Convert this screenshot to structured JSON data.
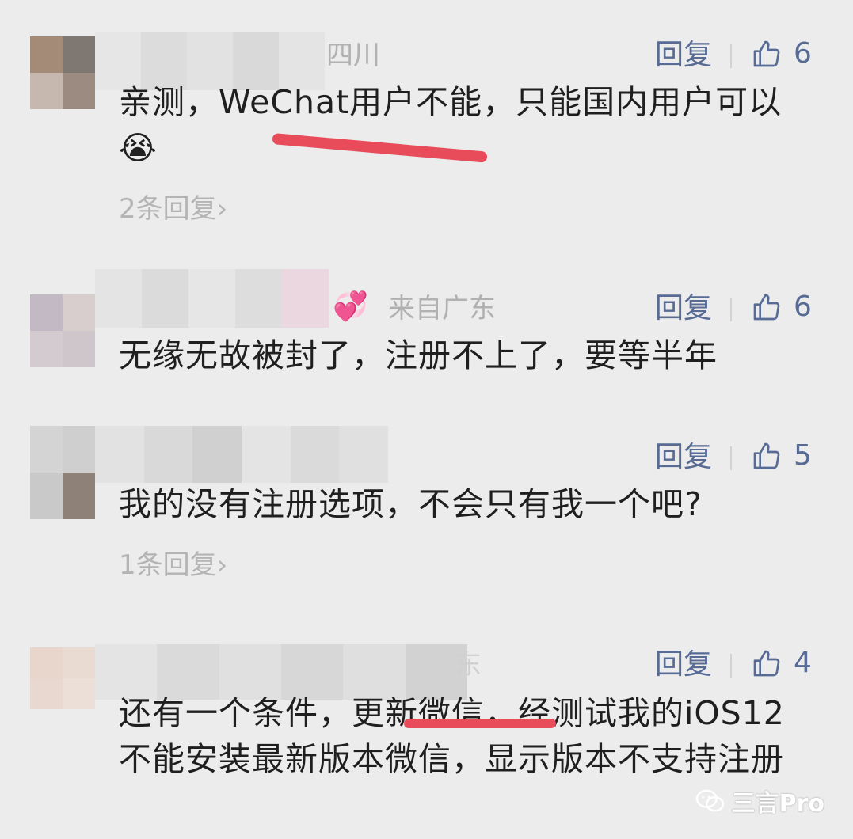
{
  "comments": [
    {
      "location": "四川",
      "reply_label": "回复",
      "likes": "6",
      "text": "亲测，WeChat用户不能，只能国内用户可以😭",
      "sub_replies": "2条回复",
      "sub_chevron": "›"
    },
    {
      "emoji": "💞",
      "location": "来自广东",
      "reply_label": "回复",
      "likes": "6",
      "text": "无缘无故被封了，注册不上了，要等半年"
    },
    {
      "reply_label": "回复",
      "likes": "5",
      "text": "我的没有注册选项，不会只有我一个吧?",
      "sub_replies": "1条回复",
      "sub_chevron": "›"
    },
    {
      "location": "东",
      "reply_label": "回复",
      "likes": "4",
      "text": "还有一个条件，更新微信，经测试我的iOS12不能安装最新版本微信，显示版本不支持注册"
    }
  ],
  "watermark": {
    "text": "三言Pro",
    "icon": "wechat-icon"
  },
  "colors": {
    "link": "#576b95",
    "underline": "#e84c5b",
    "background": "#ececec"
  }
}
